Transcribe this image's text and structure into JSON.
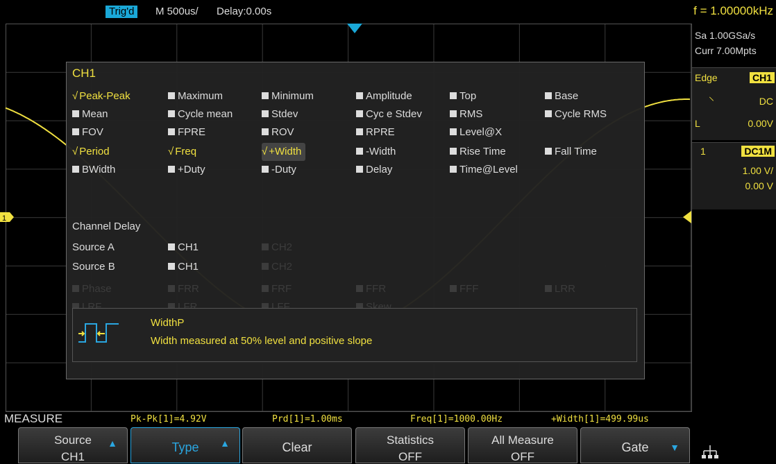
{
  "status": {
    "trig": "Trig'd",
    "timebase": "M 500us/",
    "delay": "Delay:0.00s",
    "freq": "f = 1.00000kHz"
  },
  "side": {
    "sample_rate": "Sa 1.00GSa/s",
    "memory": "Curr 7.00Mpts",
    "trigger_type": "Edge",
    "trigger_source": "CH1",
    "trigger_coupling": "DC",
    "trigger_level_label": "L",
    "trigger_level": "0.00V",
    "channel_num": "1",
    "channel_coupling": "DC1M",
    "channel_scale": "1.00 V/",
    "channel_offset": "0.00 V"
  },
  "panel": {
    "title": "CH1",
    "grid": [
      [
        {
          "t": "Peak-Peak",
          "s": "on"
        },
        {
          "t": "Maximum",
          "s": "off"
        },
        {
          "t": "Minimum",
          "s": "off"
        },
        {
          "t": "Amplitude",
          "s": "off"
        },
        {
          "t": "Top",
          "s": "off"
        },
        {
          "t": "Base",
          "s": "off"
        }
      ],
      [
        {
          "t": "Mean",
          "s": "off"
        },
        {
          "t": "Cycle mean",
          "s": "off"
        },
        {
          "t": "Stdev",
          "s": "off"
        },
        {
          "t": "Cyc e Stdev",
          "s": "off"
        },
        {
          "t": "RMS",
          "s": "off"
        },
        {
          "t": "Cycle RMS",
          "s": "off"
        }
      ],
      [
        {
          "t": "FOV",
          "s": "off"
        },
        {
          "t": "FPRE",
          "s": "off"
        },
        {
          "t": "ROV",
          "s": "off"
        },
        {
          "t": "RPRE",
          "s": "off"
        },
        {
          "t": "Level@X",
          "s": "off"
        }
      ],
      [
        {
          "t": "Period",
          "s": "on"
        },
        {
          "t": "Freq",
          "s": "on"
        },
        {
          "t": "+Width",
          "s": "on-sel"
        },
        {
          "t": "-Width",
          "s": "off"
        },
        {
          "t": "Rise Time",
          "s": "off"
        },
        {
          "t": "Fall Time",
          "s": "off"
        }
      ],
      [
        {
          "t": "BWidth",
          "s": "off"
        },
        {
          "t": "+Duty",
          "s": "off"
        },
        {
          "t": "-Duty",
          "s": "off"
        },
        {
          "t": "Delay",
          "s": "off"
        },
        {
          "t": "Time@Level",
          "s": "off"
        }
      ]
    ],
    "channel_delay": "Channel Delay",
    "source_a_label": "Source A",
    "source_b_label": "Source B",
    "source_a": [
      {
        "t": "CH1",
        "s": "off"
      },
      {
        "t": "CH2",
        "s": "dis"
      }
    ],
    "source_b": [
      {
        "t": "CH1",
        "s": "off"
      },
      {
        "t": "CH2",
        "s": "dis"
      }
    ],
    "delay_grid": [
      [
        {
          "t": "Phase",
          "s": "dis"
        },
        {
          "t": "FRR",
          "s": "dis"
        },
        {
          "t": "FRF",
          "s": "dis"
        },
        {
          "t": "FFR",
          "s": "dis"
        },
        {
          "t": "FFF",
          "s": "dis"
        },
        {
          "t": "LRR",
          "s": "dis"
        }
      ],
      [
        {
          "t": "LRF",
          "s": "dis"
        },
        {
          "t": "LFR",
          "s": "dis"
        },
        {
          "t": "LFF",
          "s": "dis"
        },
        {
          "t": "Skew",
          "s": "dis"
        }
      ]
    ],
    "info_name": "WidthP",
    "info_desc": "Width measured at 50% level and positive slope"
  },
  "measure": {
    "label": "MEASURE",
    "values": [
      "Pk-Pk[1]=4.92V",
      "Prd[1]=1.00ms",
      "Freq[1]=1000.00Hz",
      "+Width[1]=499.99us"
    ]
  },
  "softkeys": [
    {
      "l1": "Source",
      "l2": "CH1",
      "arrow": "up"
    },
    {
      "mid": "Type",
      "arrow": "up",
      "active": true
    },
    {
      "mid": "Clear"
    },
    {
      "l1": "Statistics",
      "l2": "OFF"
    },
    {
      "l1": "All Measure",
      "l2": "OFF"
    },
    {
      "mid": "Gate",
      "arrow": "down"
    }
  ],
  "colors": {
    "trace": "#f0e040",
    "accent": "#1aa8d8"
  }
}
